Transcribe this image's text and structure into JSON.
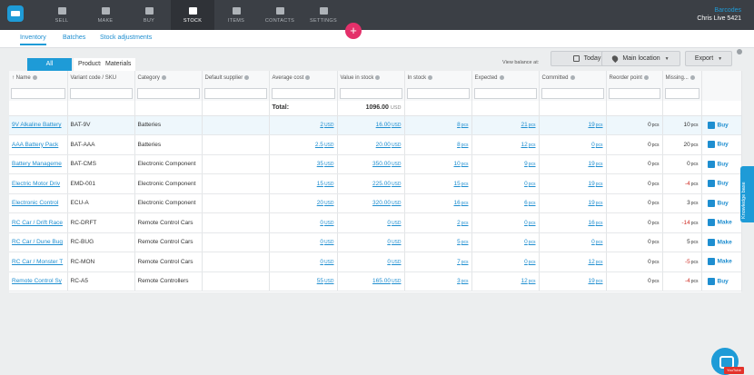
{
  "topnav": {
    "items": [
      {
        "label": "SELL",
        "icon": "sell-icon"
      },
      {
        "label": "MAKE",
        "icon": "make-icon"
      },
      {
        "label": "BUY",
        "icon": "buy-icon"
      },
      {
        "label": "STOCK",
        "icon": "stock-icon",
        "active": true
      },
      {
        "label": "ITEMS",
        "icon": "items-icon"
      },
      {
        "label": "CONTACTS",
        "icon": "contacts-icon"
      },
      {
        "label": "SETTINGS",
        "icon": "settings-icon"
      }
    ],
    "user_link": "Barcodes",
    "user_name": "Chris Live 5421"
  },
  "subtabs": {
    "inventory": "Inventory",
    "batches": "Batches",
    "stock_adjustments": "Stock adjustments"
  },
  "toolbar": {
    "filters": [
      "All",
      "Products",
      "Materials"
    ],
    "view_balance_label": "View balance at:",
    "today": "Today",
    "location": "Main location",
    "export": "Export"
  },
  "table": {
    "headers": [
      "Name",
      "Variant code / SKU",
      "Category",
      "Default supplier",
      "Average cost",
      "Value in stock",
      "In stock",
      "Expected",
      "Committed",
      "Reorder point",
      "Missing..."
    ],
    "total_label": "Total:",
    "total_value": "1096.00",
    "currency": "USD",
    "qty_unit": "pcs",
    "rows": [
      {
        "name": "9V Alkaline Battery",
        "sku": "BAT-9V",
        "category": "Batteries",
        "avg_cost": "2",
        "value": "16.00",
        "in_stock": "8",
        "expected": "21",
        "committed": "19",
        "reorder": "0",
        "missing": "10",
        "action": "Buy"
      },
      {
        "name": "AAA Battery Pack",
        "sku": "BAT-AAA",
        "category": "Batteries",
        "avg_cost": "2.5",
        "value": "20.00",
        "in_stock": "8",
        "expected": "12",
        "committed": "0",
        "reorder": "0",
        "missing": "20",
        "action": "Buy"
      },
      {
        "name": "Battery Manageme",
        "sku": "BAT-CMS",
        "category": "Electronic Component",
        "avg_cost": "35",
        "value": "350.00",
        "in_stock": "10",
        "expected": "9",
        "committed": "19",
        "reorder": "0",
        "missing": "0",
        "action": "Buy"
      },
      {
        "name": "Electric Motor Driv",
        "sku": "EMD-001",
        "category": "Electronic Component",
        "avg_cost": "15",
        "value": "225.00",
        "in_stock": "15",
        "expected": "0",
        "committed": "19",
        "reorder": "0",
        "missing": "-4",
        "action": "Buy"
      },
      {
        "name": "Electronic Control",
        "sku": "ECU-A",
        "category": "Electronic Component",
        "avg_cost": "20",
        "value": "320.00",
        "in_stock": "16",
        "expected": "6",
        "committed": "19",
        "reorder": "0",
        "missing": "3",
        "action": "Buy"
      },
      {
        "name": "RC Car / Drift Race",
        "sku": "RC-DRFT",
        "category": "Remote Control Cars",
        "avg_cost": "0",
        "value": "0",
        "in_stock": "2",
        "expected": "0",
        "committed": "16",
        "reorder": "0",
        "missing": "-14",
        "action": "Make"
      },
      {
        "name": "RC Car / Dune Bug",
        "sku": "RC-BUG",
        "category": "Remote Control Cars",
        "avg_cost": "0",
        "value": "0",
        "in_stock": "5",
        "expected": "0",
        "committed": "0",
        "reorder": "0",
        "missing": "5",
        "action": "Make"
      },
      {
        "name": "RC Car / Monster T",
        "sku": "RC-MON",
        "category": "Remote Control Cars",
        "avg_cost": "0",
        "value": "0",
        "in_stock": "7",
        "expected": "0",
        "committed": "12",
        "reorder": "0",
        "missing": "-5",
        "action": "Make"
      },
      {
        "name": "Remote Control Sy",
        "sku": "RC-A5",
        "category": "Remote Controllers",
        "avg_cost": "55",
        "value": "165.00",
        "in_stock": "3",
        "expected": "12",
        "committed": "19",
        "reorder": "0",
        "missing": "-4",
        "action": "Buy"
      }
    ]
  },
  "knowledge_base": "Knowledge base",
  "youtube_badge": "YouTube",
  "colors": {
    "accent": "#1e9bd7",
    "topbar": "#3b3f45",
    "plus": "#e4306a",
    "negative": "#d0342c"
  }
}
